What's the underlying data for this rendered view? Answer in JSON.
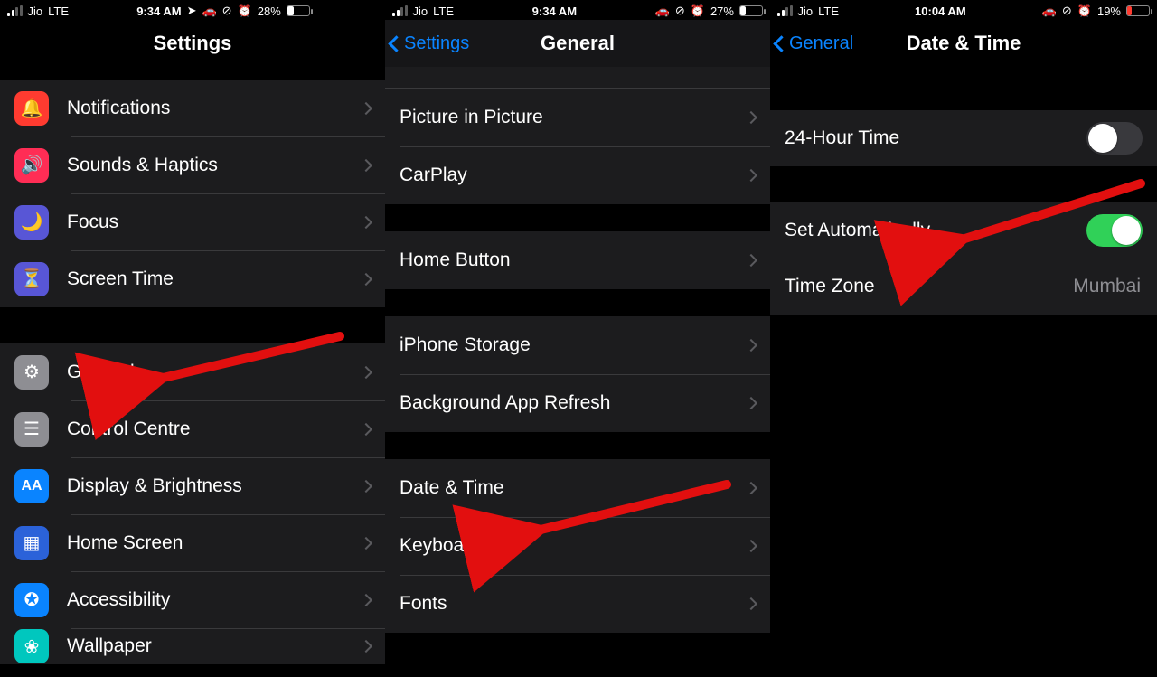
{
  "panel1": {
    "status": {
      "carrier": "Jio",
      "tech": "LTE",
      "time": "9:34 AM",
      "battery": "28%"
    },
    "title": "Settings",
    "groupA": [
      {
        "name": "notifications",
        "label": "Notifications"
      },
      {
        "name": "sounds",
        "label": "Sounds & Haptics"
      },
      {
        "name": "focus",
        "label": "Focus"
      },
      {
        "name": "screentime",
        "label": "Screen Time"
      }
    ],
    "groupB": [
      {
        "name": "general",
        "label": "General"
      },
      {
        "name": "control",
        "label": "Control Centre"
      },
      {
        "name": "display",
        "label": "Display & Brightness"
      },
      {
        "name": "home",
        "label": "Home Screen"
      },
      {
        "name": "access",
        "label": "Accessibility"
      },
      {
        "name": "wallpaper",
        "label": "Wallpaper"
      }
    ]
  },
  "panel2": {
    "status": {
      "carrier": "Jio",
      "tech": "LTE",
      "time": "9:34 AM",
      "battery": "27%"
    },
    "back": "Settings",
    "title": "General",
    "groupA": [
      {
        "label": "Picture in Picture"
      },
      {
        "label": "CarPlay"
      }
    ],
    "groupB": [
      {
        "label": "Home Button"
      }
    ],
    "groupC": [
      {
        "label": "iPhone Storage"
      },
      {
        "label": "Background App Refresh"
      }
    ],
    "groupD": [
      {
        "label": "Date & Time"
      },
      {
        "label": "Keyboard"
      },
      {
        "label": "Fonts"
      }
    ]
  },
  "panel3": {
    "status": {
      "carrier": "Jio",
      "tech": "LTE",
      "time": "10:04 AM",
      "battery": "19%"
    },
    "back": "General",
    "title": "Date & Time",
    "row24": {
      "label": "24-Hour Time",
      "on": false
    },
    "rowAuto": {
      "label": "Set Automatically",
      "on": true
    },
    "rowTZ": {
      "label": "Time Zone",
      "value": "Mumbai"
    }
  }
}
